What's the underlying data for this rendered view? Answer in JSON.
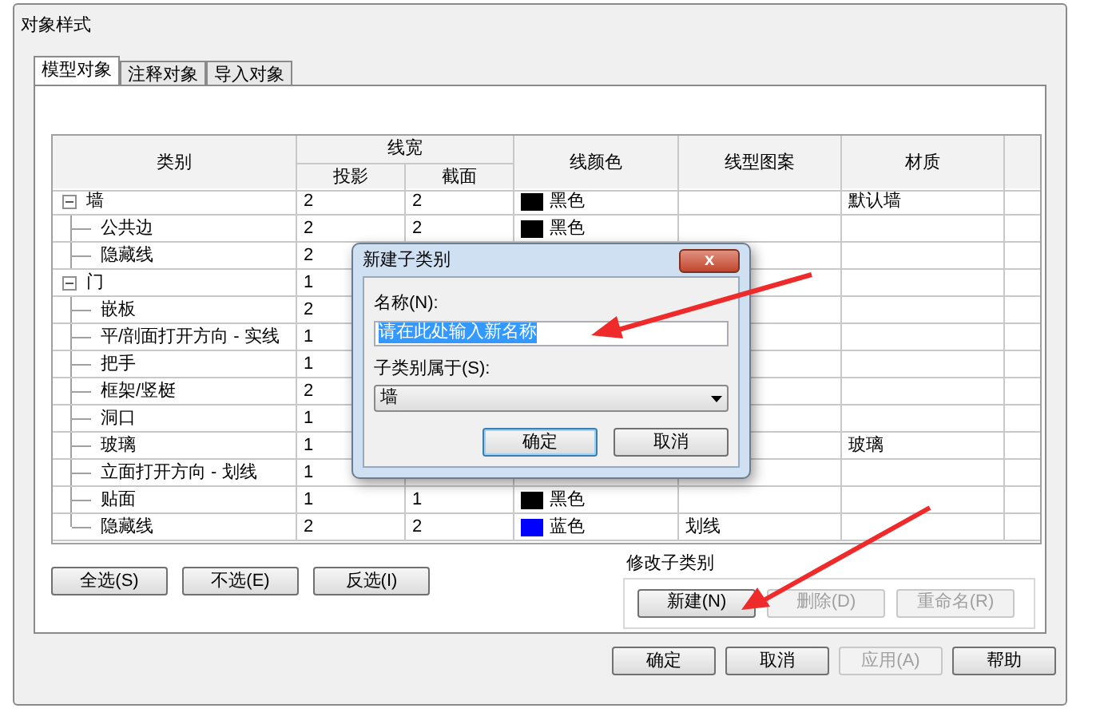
{
  "window": {
    "title": "对象样式"
  },
  "tabs": [
    {
      "label": "模型对象",
      "selected": true
    },
    {
      "label": "注释对象",
      "selected": false
    },
    {
      "label": "导入对象",
      "selected": false
    }
  ],
  "table": {
    "columns": {
      "category": "类别",
      "line_weight": "线宽",
      "projection": "投影",
      "cut": "截面",
      "line_color": "线颜色",
      "line_pattern": "线型图案",
      "material": "材质"
    },
    "rows": [
      {
        "name": "墙",
        "expanded": true,
        "projection": "2",
        "cut": "2",
        "line_color": {
          "name": "黑色",
          "color": "#000000"
        },
        "material": "默认墙",
        "children": [
          {
            "name": "公共边",
            "projection": "2",
            "cut": "2",
            "line_color": {
              "name": "黑色",
              "color": "#000000"
            }
          },
          {
            "name": "隐藏线",
            "projection": "2"
          }
        ]
      },
      {
        "name": "门",
        "expanded": true,
        "projection": "1",
        "children": [
          {
            "name": "嵌板",
            "projection": "2"
          },
          {
            "name": "平/剖面打开方向 - 实线",
            "projection": "1"
          },
          {
            "name": "把手",
            "projection": "1"
          },
          {
            "name": "框架/竖梃",
            "projection": "2"
          },
          {
            "name": "洞口",
            "projection": "1"
          },
          {
            "name": "玻璃",
            "projection": "1",
            "material": "玻璃"
          },
          {
            "name": "立面打开方向 - 划线",
            "projection": "1"
          },
          {
            "name": "贴面",
            "projection": "1",
            "cut": "1",
            "line_color": {
              "name": "黑色",
              "color": "#000000"
            }
          },
          {
            "name": "隐藏线",
            "projection": "2",
            "cut": "2",
            "line_color": {
              "name": "蓝色",
              "color": "#0000ff"
            },
            "line_pattern": "划线"
          }
        ]
      }
    ]
  },
  "selection_buttons": [
    {
      "label": "全选(S)",
      "disabled": false
    },
    {
      "label": "不选(E)",
      "disabled": false
    },
    {
      "label": "反选(I)",
      "disabled": false
    }
  ],
  "modify_subcategories": {
    "title": "修改子类别",
    "buttons": [
      {
        "label": "新建(N)",
        "disabled": false
      },
      {
        "label": "删除(D)",
        "disabled": true
      },
      {
        "label": "重命名(R)",
        "disabled": true
      }
    ]
  },
  "footer_buttons": [
    {
      "label": "确定",
      "disabled": false
    },
    {
      "label": "取消",
      "disabled": false
    },
    {
      "label": "应用(A)",
      "disabled": true
    },
    {
      "label": "帮助",
      "disabled": false
    }
  ],
  "dialog": {
    "title": "新建子类别",
    "close": "x",
    "name_label": "名称(N):",
    "name_value": "请在此处输入新名称",
    "parent_label": "子类别属于(S):",
    "parent_value": "墙",
    "buttons": [
      {
        "label": "确定",
        "default": true
      },
      {
        "label": "取消",
        "default": false
      }
    ]
  }
}
